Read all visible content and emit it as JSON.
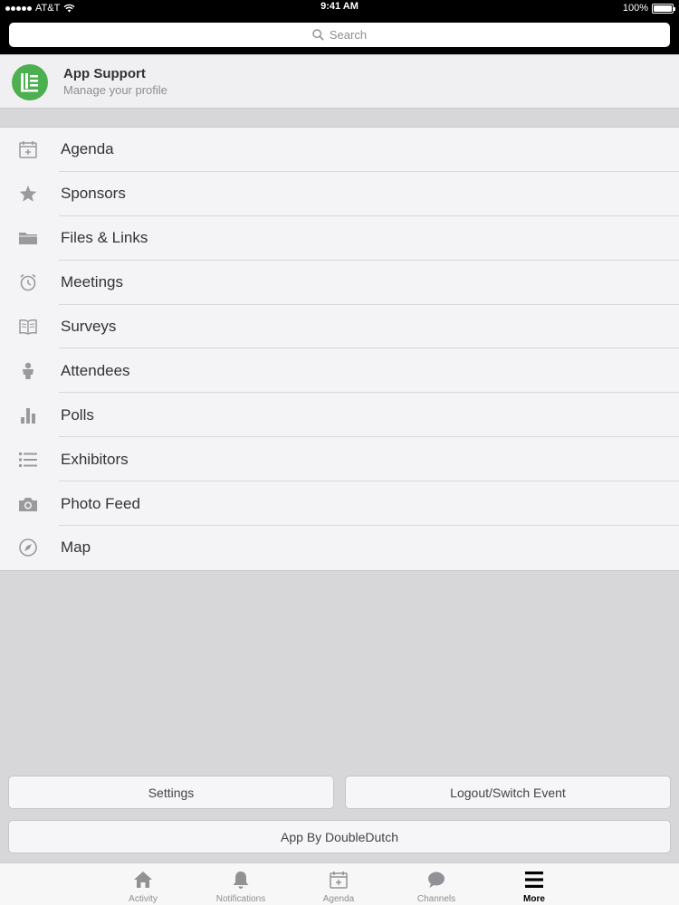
{
  "status_bar": {
    "carrier": "AT&T",
    "time": "9:41 AM",
    "battery": "100%"
  },
  "search": {
    "placeholder": "Search"
  },
  "profile": {
    "name": "App Support",
    "subtitle": "Manage your profile"
  },
  "menu": {
    "items": [
      {
        "label": "Agenda",
        "icon": "calendar-icon"
      },
      {
        "label": "Sponsors",
        "icon": "star-icon"
      },
      {
        "label": "Files & Links",
        "icon": "folder-icon"
      },
      {
        "label": "Meetings",
        "icon": "alarm-clock-icon"
      },
      {
        "label": "Surveys",
        "icon": "open-book-icon"
      },
      {
        "label": "Attendees",
        "icon": "person-icon"
      },
      {
        "label": "Polls",
        "icon": "bar-chart-icon"
      },
      {
        "label": "Exhibitors",
        "icon": "list-icon"
      },
      {
        "label": "Photo Feed",
        "icon": "camera-icon"
      },
      {
        "label": "Map",
        "icon": "compass-icon"
      }
    ]
  },
  "buttons": {
    "settings": "Settings",
    "logout": "Logout/Switch Event",
    "app_by": "App By DoubleDutch"
  },
  "tabs": [
    {
      "label": "Activity",
      "icon": "home-icon"
    },
    {
      "label": "Notifications",
      "icon": "bell-icon"
    },
    {
      "label": "Agenda",
      "icon": "calendar-icon"
    },
    {
      "label": "Channels",
      "icon": "chat-bubble-icon"
    },
    {
      "label": "More",
      "icon": "hamburger-menu-icon",
      "active": true
    }
  ],
  "colors": {
    "accent_green": "#4caf50",
    "icon_gray": "#9a9a9e",
    "background": "#d7d7d9"
  }
}
